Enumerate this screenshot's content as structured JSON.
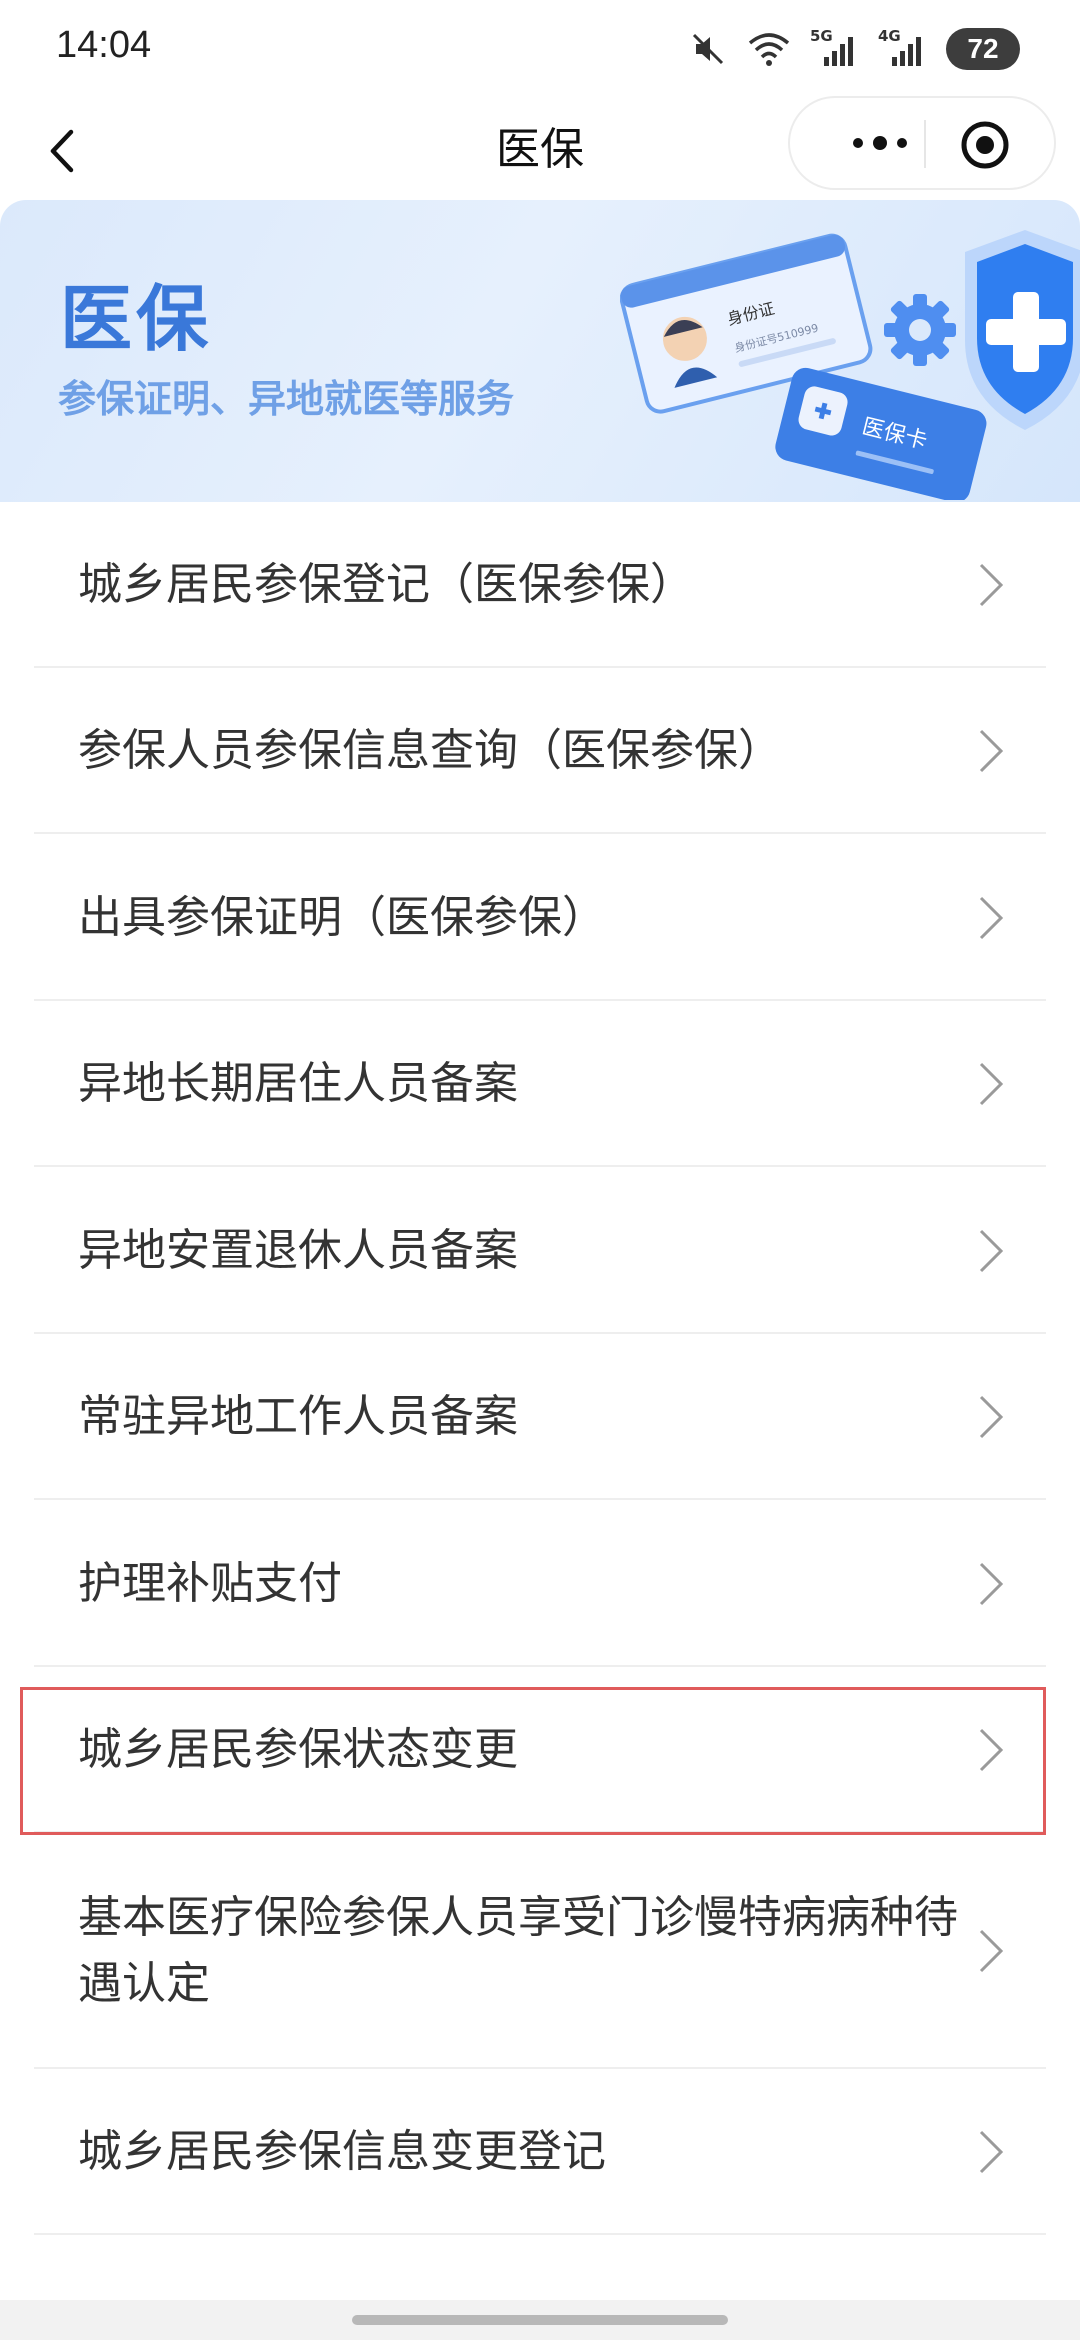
{
  "status_bar": {
    "time": "14:04",
    "battery": "72",
    "icons": [
      "mute-icon",
      "wifi-icon",
      "signal-5g-icon",
      "signal-4g-icon"
    ],
    "network_labels": [
      "5G",
      "4G"
    ]
  },
  "nav": {
    "title": "医保",
    "icons": [
      "back-arrow-icon",
      "more-dots-icon",
      "close-target-icon"
    ]
  },
  "banner": {
    "title": "医保",
    "subtitle": "参保证明、异地就医等服务",
    "id_card_title": "身份证",
    "id_card_number": "身份证号510999",
    "insurance_card_label": "医保卡",
    "colors": {
      "accent": "#3a78d9",
      "subtitle": "#6fa0e6"
    }
  },
  "menu": {
    "items": [
      {
        "label": "城乡居民参保登记（医保参保）"
      },
      {
        "label": "参保人员参保信息查询（医保参保）"
      },
      {
        "label": "出具参保证明（医保参保）"
      },
      {
        "label": "异地长期居住人员备案"
      },
      {
        "label": "异地安置退休人员备案"
      },
      {
        "label": "常驻异地工作人员备案"
      },
      {
        "label": "护理补贴支付"
      },
      {
        "label": "城乡居民参保状态变更",
        "highlighted": true
      },
      {
        "label": "基本医疗保险参保人员享受门诊慢特病病种待遇认定"
      },
      {
        "label": "城乡居民参保信息变更登记"
      }
    ],
    "highlight_color": "#e05b5b"
  }
}
